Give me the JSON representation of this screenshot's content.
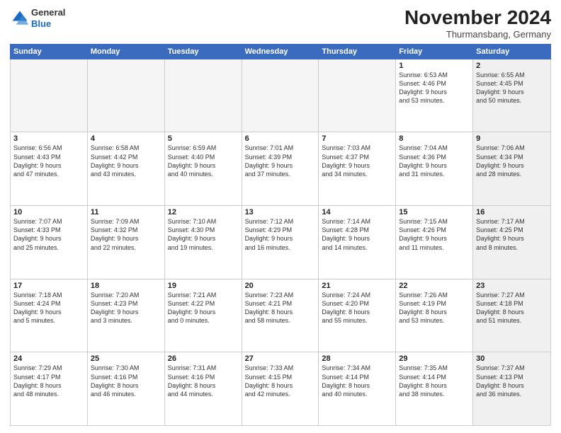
{
  "logo": {
    "line1": "General",
    "line2": "Blue"
  },
  "title": "November 2024",
  "location": "Thurmansbang, Germany",
  "header_days": [
    "Sunday",
    "Monday",
    "Tuesday",
    "Wednesday",
    "Thursday",
    "Friday",
    "Saturday"
  ],
  "rows": [
    [
      {
        "day": "",
        "info": "",
        "empty": true
      },
      {
        "day": "",
        "info": "",
        "empty": true
      },
      {
        "day": "",
        "info": "",
        "empty": true
      },
      {
        "day": "",
        "info": "",
        "empty": true
      },
      {
        "day": "",
        "info": "",
        "empty": true
      },
      {
        "day": "1",
        "info": "Sunrise: 6:53 AM\nSunset: 4:46 PM\nDaylight: 9 hours\nand 53 minutes.",
        "empty": false,
        "shaded": false
      },
      {
        "day": "2",
        "info": "Sunrise: 6:55 AM\nSunset: 4:45 PM\nDaylight: 9 hours\nand 50 minutes.",
        "empty": false,
        "shaded": true
      }
    ],
    [
      {
        "day": "3",
        "info": "Sunrise: 6:56 AM\nSunset: 4:43 PM\nDaylight: 9 hours\nand 47 minutes.",
        "empty": false,
        "shaded": false
      },
      {
        "day": "4",
        "info": "Sunrise: 6:58 AM\nSunset: 4:42 PM\nDaylight: 9 hours\nand 43 minutes.",
        "empty": false,
        "shaded": false
      },
      {
        "day": "5",
        "info": "Sunrise: 6:59 AM\nSunset: 4:40 PM\nDaylight: 9 hours\nand 40 minutes.",
        "empty": false,
        "shaded": false
      },
      {
        "day": "6",
        "info": "Sunrise: 7:01 AM\nSunset: 4:39 PM\nDaylight: 9 hours\nand 37 minutes.",
        "empty": false,
        "shaded": false
      },
      {
        "day": "7",
        "info": "Sunrise: 7:03 AM\nSunset: 4:37 PM\nDaylight: 9 hours\nand 34 minutes.",
        "empty": false,
        "shaded": false
      },
      {
        "day": "8",
        "info": "Sunrise: 7:04 AM\nSunset: 4:36 PM\nDaylight: 9 hours\nand 31 minutes.",
        "empty": false,
        "shaded": false
      },
      {
        "day": "9",
        "info": "Sunrise: 7:06 AM\nSunset: 4:34 PM\nDaylight: 9 hours\nand 28 minutes.",
        "empty": false,
        "shaded": true
      }
    ],
    [
      {
        "day": "10",
        "info": "Sunrise: 7:07 AM\nSunset: 4:33 PM\nDaylight: 9 hours\nand 25 minutes.",
        "empty": false,
        "shaded": false
      },
      {
        "day": "11",
        "info": "Sunrise: 7:09 AM\nSunset: 4:32 PM\nDaylight: 9 hours\nand 22 minutes.",
        "empty": false,
        "shaded": false
      },
      {
        "day": "12",
        "info": "Sunrise: 7:10 AM\nSunset: 4:30 PM\nDaylight: 9 hours\nand 19 minutes.",
        "empty": false,
        "shaded": false
      },
      {
        "day": "13",
        "info": "Sunrise: 7:12 AM\nSunset: 4:29 PM\nDaylight: 9 hours\nand 16 minutes.",
        "empty": false,
        "shaded": false
      },
      {
        "day": "14",
        "info": "Sunrise: 7:14 AM\nSunset: 4:28 PM\nDaylight: 9 hours\nand 14 minutes.",
        "empty": false,
        "shaded": false
      },
      {
        "day": "15",
        "info": "Sunrise: 7:15 AM\nSunset: 4:26 PM\nDaylight: 9 hours\nand 11 minutes.",
        "empty": false,
        "shaded": false
      },
      {
        "day": "16",
        "info": "Sunrise: 7:17 AM\nSunset: 4:25 PM\nDaylight: 9 hours\nand 8 minutes.",
        "empty": false,
        "shaded": true
      }
    ],
    [
      {
        "day": "17",
        "info": "Sunrise: 7:18 AM\nSunset: 4:24 PM\nDaylight: 9 hours\nand 5 minutes.",
        "empty": false,
        "shaded": false
      },
      {
        "day": "18",
        "info": "Sunrise: 7:20 AM\nSunset: 4:23 PM\nDaylight: 9 hours\nand 3 minutes.",
        "empty": false,
        "shaded": false
      },
      {
        "day": "19",
        "info": "Sunrise: 7:21 AM\nSunset: 4:22 PM\nDaylight: 9 hours\nand 0 minutes.",
        "empty": false,
        "shaded": false
      },
      {
        "day": "20",
        "info": "Sunrise: 7:23 AM\nSunset: 4:21 PM\nDaylight: 8 hours\nand 58 minutes.",
        "empty": false,
        "shaded": false
      },
      {
        "day": "21",
        "info": "Sunrise: 7:24 AM\nSunset: 4:20 PM\nDaylight: 8 hours\nand 55 minutes.",
        "empty": false,
        "shaded": false
      },
      {
        "day": "22",
        "info": "Sunrise: 7:26 AM\nSunset: 4:19 PM\nDaylight: 8 hours\nand 53 minutes.",
        "empty": false,
        "shaded": false
      },
      {
        "day": "23",
        "info": "Sunrise: 7:27 AM\nSunset: 4:18 PM\nDaylight: 8 hours\nand 51 minutes.",
        "empty": false,
        "shaded": true
      }
    ],
    [
      {
        "day": "24",
        "info": "Sunrise: 7:29 AM\nSunset: 4:17 PM\nDaylight: 8 hours\nand 48 minutes.",
        "empty": false,
        "shaded": false
      },
      {
        "day": "25",
        "info": "Sunrise: 7:30 AM\nSunset: 4:16 PM\nDaylight: 8 hours\nand 46 minutes.",
        "empty": false,
        "shaded": false
      },
      {
        "day": "26",
        "info": "Sunrise: 7:31 AM\nSunset: 4:16 PM\nDaylight: 8 hours\nand 44 minutes.",
        "empty": false,
        "shaded": false
      },
      {
        "day": "27",
        "info": "Sunrise: 7:33 AM\nSunset: 4:15 PM\nDaylight: 8 hours\nand 42 minutes.",
        "empty": false,
        "shaded": false
      },
      {
        "day": "28",
        "info": "Sunrise: 7:34 AM\nSunset: 4:14 PM\nDaylight: 8 hours\nand 40 minutes.",
        "empty": false,
        "shaded": false
      },
      {
        "day": "29",
        "info": "Sunrise: 7:35 AM\nSunset: 4:14 PM\nDaylight: 8 hours\nand 38 minutes.",
        "empty": false,
        "shaded": false
      },
      {
        "day": "30",
        "info": "Sunrise: 7:37 AM\nSunset: 4:13 PM\nDaylight: 8 hours\nand 36 minutes.",
        "empty": false,
        "shaded": true
      }
    ]
  ]
}
